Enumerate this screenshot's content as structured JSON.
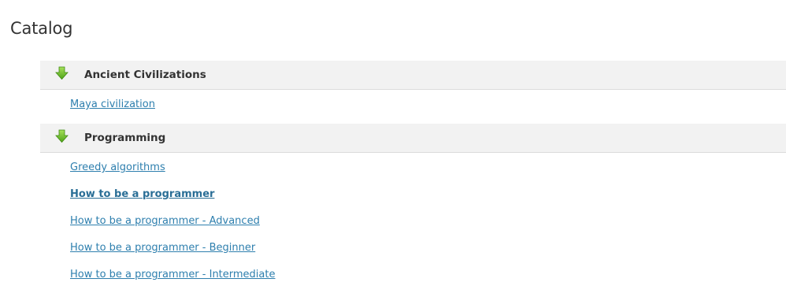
{
  "page": {
    "title": "Catalog"
  },
  "colors": {
    "link": "#2e7fae",
    "header_bg": "#f2f2f2",
    "icon_green": "#6fbf2b"
  },
  "categories": [
    {
      "title": "Ancient Civilizations",
      "icon": "green-down-arrow-icon",
      "courses": [
        {
          "label": "Maya civilization",
          "current": false
        }
      ]
    },
    {
      "title": "Programming",
      "icon": "green-down-arrow-icon",
      "courses": [
        {
          "label": "Greedy algorithms",
          "current": false
        },
        {
          "label": "How to be a programmer",
          "current": true
        },
        {
          "label": "How to be a programmer - Advanced",
          "current": false
        },
        {
          "label": "How to be a programmer - Beginner",
          "current": false
        },
        {
          "label": "How to be a programmer - Intermediate",
          "current": false
        }
      ]
    }
  ]
}
